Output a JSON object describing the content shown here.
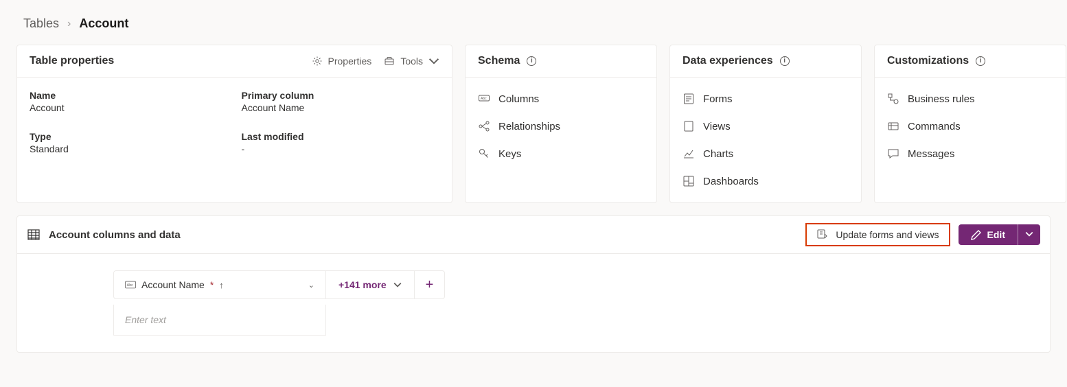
{
  "breadcrumb": {
    "root": "Tables",
    "current": "Account"
  },
  "properties_card": {
    "title": "Table properties",
    "properties_action": "Properties",
    "tools_action": "Tools",
    "fields": {
      "name_label": "Name",
      "name_value": "Account",
      "primary_label": "Primary column",
      "primary_value": "Account Name",
      "type_label": "Type",
      "type_value": "Standard",
      "modified_label": "Last modified",
      "modified_value": "-"
    }
  },
  "schema_card": {
    "title": "Schema",
    "items": {
      "columns": "Columns",
      "relationships": "Relationships",
      "keys": "Keys"
    }
  },
  "data_card": {
    "title": "Data experiences",
    "items": {
      "forms": "Forms",
      "views": "Views",
      "charts": "Charts",
      "dashboards": "Dashboards"
    }
  },
  "custom_card": {
    "title": "Customizations",
    "items": {
      "rules": "Business rules",
      "commands": "Commands",
      "messages": "Messages"
    }
  },
  "data_panel": {
    "title": "Account columns and data",
    "update_label": "Update forms and views",
    "edit_label": "Edit",
    "column_header": "Account Name",
    "more_label": "+141 more",
    "input_placeholder": "Enter text"
  }
}
